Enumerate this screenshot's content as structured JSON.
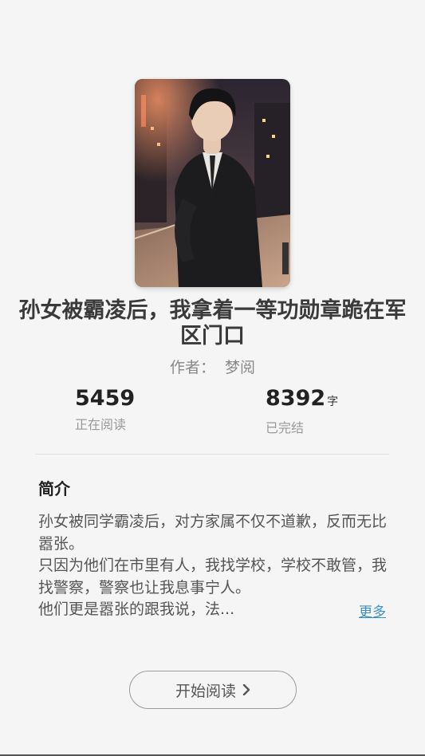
{
  "book": {
    "cover_alt": "cover-image",
    "title": "孙女被霸凌后，我拿着一等功勋章跪在军区门口",
    "author_label": "作者：",
    "author_name": "梦阅"
  },
  "stats": {
    "reading_count": "5459",
    "reading_label": "正在阅读",
    "word_count": "8392",
    "word_unit": "字",
    "status_label": "已完结"
  },
  "intro": {
    "heading": "简介",
    "line1": "孙女被同学霸凌后，对方家属不仅不道歉，反而无比嚣张。",
    "line2": "只因为他们在市里有人，我找学校，学校不敢管，我找警察，警察也让我息事宁人。",
    "line3": "他们更是嚣张的跟我说，法...",
    "more_label": "更多"
  },
  "actions": {
    "start_reading_label": "开始阅读"
  },
  "colors": {
    "background": "#f5f5f5",
    "link": "#3a8fc9"
  }
}
